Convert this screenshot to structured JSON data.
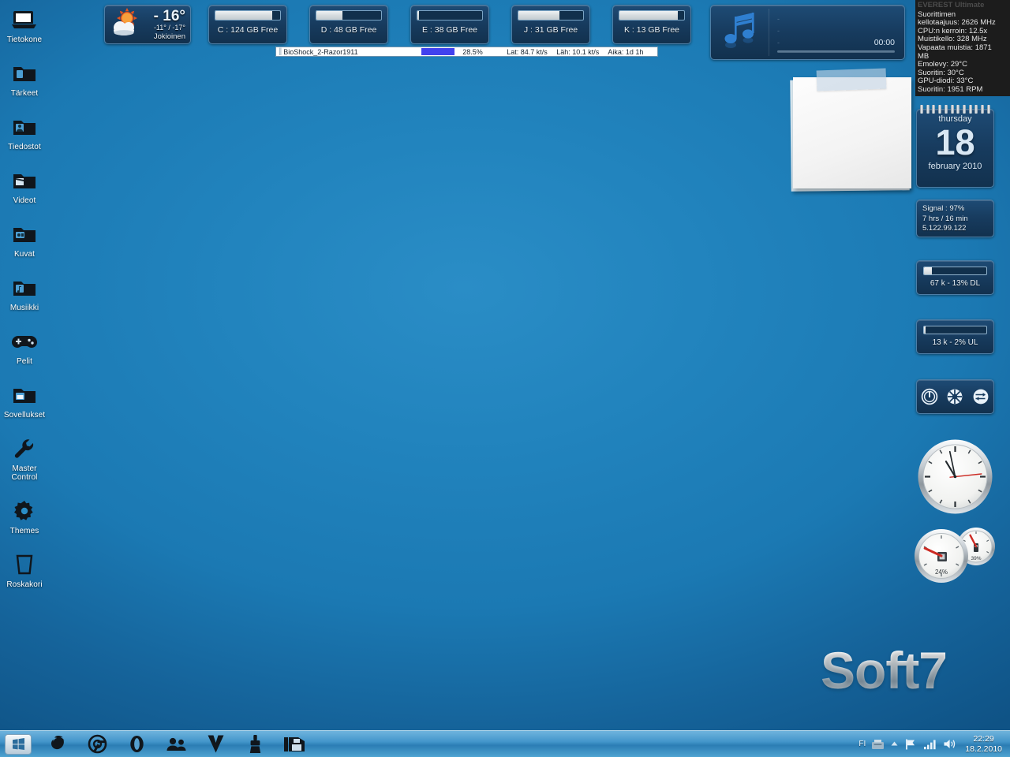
{
  "desktop": {
    "icons": [
      {
        "label": "Tietokone",
        "icon": "computer-icon"
      },
      {
        "label": "Tärkeet",
        "icon": "folder-documents-icon"
      },
      {
        "label": "Tiedostot",
        "icon": "folder-user-icon"
      },
      {
        "label": "Videot",
        "icon": "folder-video-icon"
      },
      {
        "label": "Kuvat",
        "icon": "folder-pictures-icon"
      },
      {
        "label": "Musiikki",
        "icon": "folder-music-icon"
      },
      {
        "label": "Pelit",
        "icon": "gamepad-icon"
      },
      {
        "label": "Sovellukset",
        "icon": "folder-apps-icon"
      },
      {
        "label": "Master Control",
        "icon": "wrench-icon"
      },
      {
        "label": "Themes",
        "icon": "gear-icon"
      },
      {
        "label": "Roskakori",
        "icon": "recycle-bin-icon"
      }
    ],
    "branding": "Soft7"
  },
  "weather": {
    "temp": "- 16°",
    "hilo": "-11° / -17°",
    "city": "Jokioinen",
    "condition_icon": "sun-cloud-icon"
  },
  "drives": [
    {
      "label": "C : 124 GB Free",
      "used_percent": 88
    },
    {
      "label": "D : 48 GB Free",
      "used_percent": 40
    },
    {
      "label": "E : 38 GB Free",
      "used_percent": 2
    },
    {
      "label": "J : 31 GB Free",
      "used_percent": 64
    },
    {
      "label": "K : 13 GB Free",
      "used_percent": 90
    }
  ],
  "torrent": {
    "name": "BioShock_2-Razor1911",
    "percent": "28.5%",
    "download": "Lat: 84.7 kt/s",
    "upload": "Läh: 10.1 kt/s",
    "elapsed": "Aika: 1d 1h"
  },
  "media": {
    "line1": "-",
    "line2": "-",
    "line3": "-",
    "time": "00:00"
  },
  "everest": {
    "title": "EVEREST Ultimate",
    "lines": [
      "Suorittimen",
      "kellotaajuus: 2626 MHz",
      "CPU:n kerroin: 12.5x",
      "Muistikello: 328 MHz",
      "Vapaata muistia: 1871",
      "MB",
      "Emolevy: 29°C",
      "Suoritin: 30°C",
      "GPU-diodi: 33°C",
      "Suoritin: 1951 RPM"
    ]
  },
  "calendar": {
    "weekday": "thursday",
    "day": "18",
    "month_year": "february 2010"
  },
  "signal": {
    "strength": "Signal : 97%",
    "uptime": "7 hrs / 16 min",
    "address": "5.122.99.122"
  },
  "download_meter": {
    "label": "67 k - 13% DL",
    "percent": 13
  },
  "upload_meter": {
    "label": "13 k - 2% UL",
    "percent": 2
  },
  "power": {
    "shutdown": "power-icon",
    "restart": "restart-icon",
    "logoff": "switch-user-icon"
  },
  "gauges": {
    "cpu": {
      "value": "24%",
      "percent": 24,
      "icon": "cpu-chip-icon"
    },
    "ram": {
      "value": "39%",
      "percent": 39,
      "icon": "memory-stick-icon"
    }
  },
  "clock_analog": {
    "hour": 10,
    "minute": 58,
    "second": 14
  },
  "taskbar": {
    "start": "windows-start-icon",
    "items": [
      {
        "name": "firefox-icon"
      },
      {
        "name": "chrome-icon"
      },
      {
        "name": "opera-icon"
      },
      {
        "name": "messenger-icon"
      },
      {
        "name": "winamp-icon"
      },
      {
        "name": "cleaner-icon"
      },
      {
        "name": "explorer-icon"
      }
    ],
    "tray": {
      "language": "FI",
      "icons": [
        "safely-remove-icon",
        "show-hidden-icon",
        "flag-action-center-icon",
        "network-icon",
        "volume-icon"
      ],
      "time": "22:29",
      "date": "18.2.2010"
    }
  },
  "colors": {
    "desktop_blue": "#1b79b3",
    "gadget_blue": "#173b5e",
    "torrent_bar": "#4141ee",
    "everest_bg": "#1c1c1c"
  }
}
